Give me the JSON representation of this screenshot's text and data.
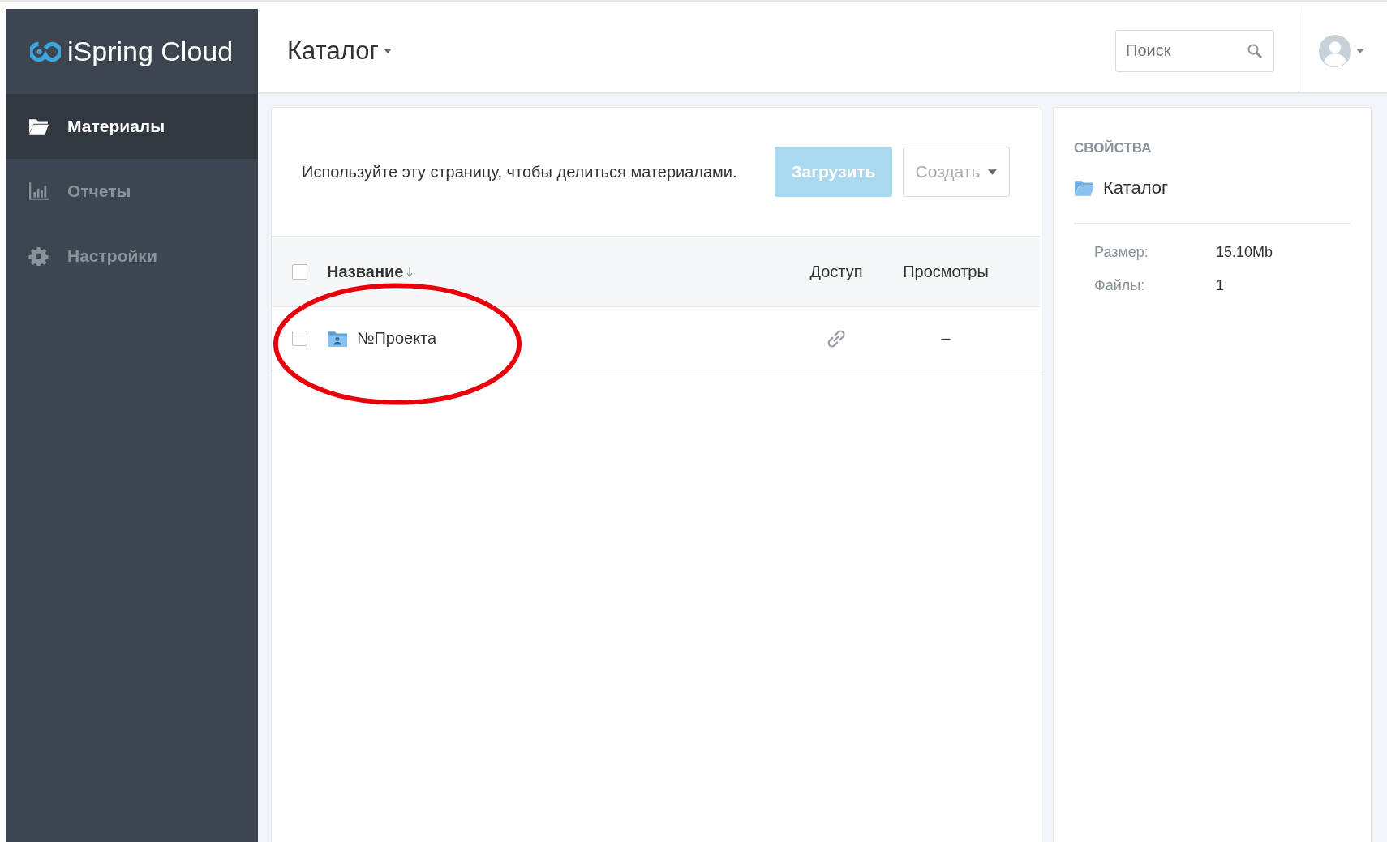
{
  "logo": {
    "text": "iSpring Cloud"
  },
  "sidebar": {
    "items": [
      {
        "label": "Материалы",
        "kind": "folder",
        "selected": true
      },
      {
        "label": "Отчеты",
        "kind": "chart",
        "selected": false
      },
      {
        "label": "Настройки",
        "kind": "gear",
        "selected": false
      }
    ]
  },
  "header": {
    "title": "Каталог",
    "search": {
      "placeholder": "Поиск"
    }
  },
  "content": {
    "description": "Используйте эту страницу, чтобы делиться материалами.",
    "buttons": [
      {
        "label": "Загрузить",
        "kind": "primary"
      },
      {
        "label": "Создать",
        "kind": "dropdown"
      }
    ],
    "table": {
      "select_all": {
        "checked": false
      },
      "columns": [
        "Название",
        "Доступ",
        "Просмотры"
      ],
      "rows": [
        {
          "name": "№Проекта",
          "checked": false,
          "views": "–"
        }
      ]
    }
  },
  "properties": {
    "heading": "СВОЙСТВА",
    "folder": "Каталог",
    "fields": [
      {
        "label": "Размер:",
        "value": "15.10Mb"
      },
      {
        "label": "Файлы:",
        "value": "1"
      }
    ]
  }
}
